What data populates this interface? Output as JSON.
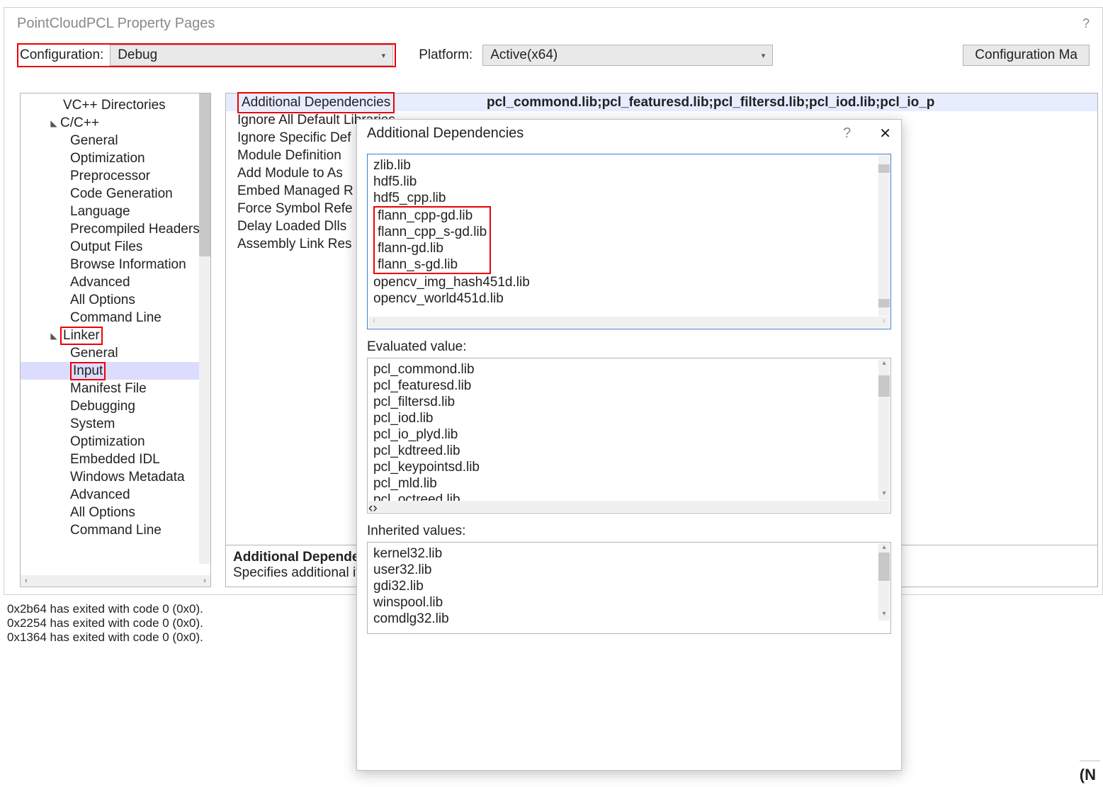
{
  "window": {
    "title": "PointCloudPCL Property Pages",
    "help": "?"
  },
  "toolbar": {
    "configuration_label": "Configuration:",
    "configuration_value": "Debug",
    "platform_label": "Platform:",
    "platform_value": "Active(x64)",
    "config_mgr_label": "Configuration Ma"
  },
  "tree": [
    {
      "label": "VC++ Directories",
      "indent": 2,
      "arrow": ""
    },
    {
      "label": "C/C++",
      "indent": 1,
      "arrow": "◣"
    },
    {
      "label": "General",
      "indent": 3
    },
    {
      "label": "Optimization",
      "indent": 3
    },
    {
      "label": "Preprocessor",
      "indent": 3
    },
    {
      "label": "Code Generation",
      "indent": 3
    },
    {
      "label": "Language",
      "indent": 3
    },
    {
      "label": "Precompiled Headers",
      "indent": 3
    },
    {
      "label": "Output Files",
      "indent": 3
    },
    {
      "label": "Browse Information",
      "indent": 3
    },
    {
      "label": "Advanced",
      "indent": 3
    },
    {
      "label": "All Options",
      "indent": 3
    },
    {
      "label": "Command Line",
      "indent": 3
    },
    {
      "label": "Linker",
      "indent": 1,
      "arrow": "◣",
      "red": true
    },
    {
      "label": "General",
      "indent": 3
    },
    {
      "label": "Input",
      "indent": 3,
      "selected": true,
      "red": true
    },
    {
      "label": "Manifest File",
      "indent": 3
    },
    {
      "label": "Debugging",
      "indent": 3
    },
    {
      "label": "System",
      "indent": 3
    },
    {
      "label": "Optimization",
      "indent": 3
    },
    {
      "label": "Embedded IDL",
      "indent": 3
    },
    {
      "label": "Windows Metadata",
      "indent": 3
    },
    {
      "label": "Advanced",
      "indent": 3
    },
    {
      "label": "All Options",
      "indent": 3
    },
    {
      "label": "Command Line",
      "indent": 3
    }
  ],
  "grid": {
    "rows": [
      {
        "name": "Additional Dependencies",
        "value": "pcl_commond.lib;pcl_featuresd.lib;pcl_filtersd.lib;pcl_iod.lib;pcl_io_p",
        "red_name": true,
        "selected": true
      },
      {
        "name": "Ignore All Default Libraries",
        "value": ""
      },
      {
        "name": "Ignore Specific Def",
        "value": ""
      },
      {
        "name": "Module Definition",
        "value": ""
      },
      {
        "name": "Add Module to As",
        "value": ""
      },
      {
        "name": "Embed Managed R",
        "value": ""
      },
      {
        "name": "Force Symbol Refe",
        "value": ""
      },
      {
        "name": "Delay Loaded Dlls",
        "value": ""
      },
      {
        "name": "Assembly Link Res",
        "value": ""
      }
    ]
  },
  "desc": {
    "title": "Additional Dependen",
    "text": "Specifies additional it"
  },
  "dialog": {
    "title": "Additional Dependencies",
    "help": "?",
    "close": "✕",
    "edit_lines_plain_before": [
      "zlib.lib",
      "hdf5.lib",
      "hdf5_cpp.lib"
    ],
    "edit_lines_red": [
      "flann_cpp-gd.lib",
      "flann_cpp_s-gd.lib",
      "flann-gd.lib",
      "flann_s-gd.lib"
    ],
    "edit_lines_plain_after": [
      "opencv_img_hash451d.lib",
      "opencv_world451d.lib"
    ],
    "evaluated_label": "Evaluated value:",
    "evaluated_lines": [
      "pcl_commond.lib",
      "pcl_featuresd.lib",
      "pcl_filtersd.lib",
      "pcl_iod.lib",
      "pcl_io_plyd.lib",
      "pcl_kdtreed.lib",
      "pcl_keypointsd.lib",
      "pcl_mld.lib",
      "pcl_octreed.lib"
    ],
    "inherited_label": "Inherited values:",
    "inherited_lines": [
      "kernel32.lib",
      "user32.lib",
      "gdi32.lib",
      "winspool.lib",
      "comdlg32.lib"
    ]
  },
  "output": {
    "lines": [
      "0x2b64 has exited with code 0 (0x0).",
      "0x2254 has exited with code 0 (0x0).",
      "0x1364 has exited with code 0 (0x0)."
    ]
  },
  "bottom_right": "(N"
}
